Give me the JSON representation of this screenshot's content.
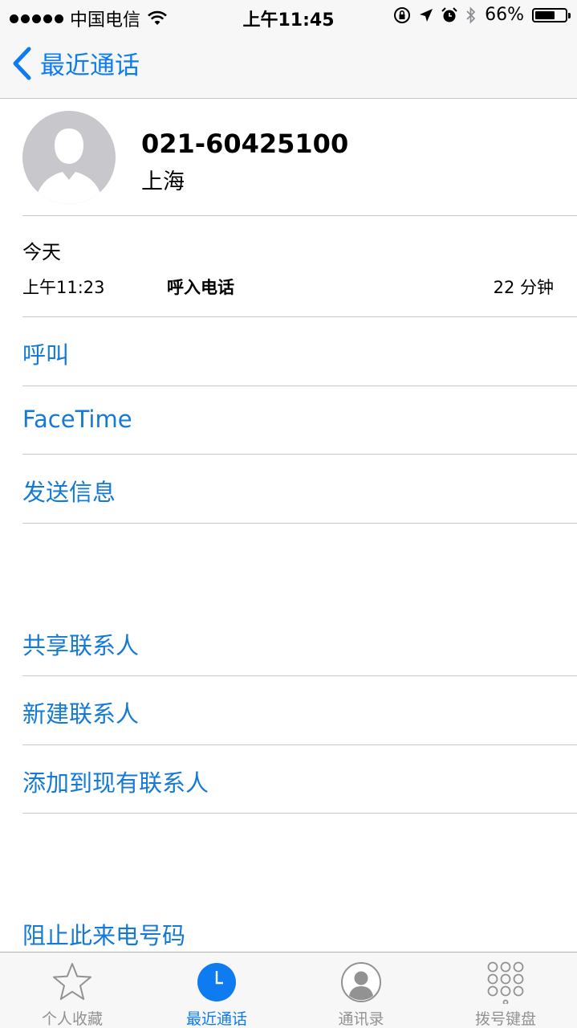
{
  "status_bar": {
    "carrier": "中国电信",
    "time": "上午11:45",
    "battery_percent": "66%",
    "battery_level": 0.66
  },
  "nav": {
    "back_label": "最近通话"
  },
  "contact": {
    "number": "021-60425100",
    "location": "上海"
  },
  "call_log": {
    "date": "今天",
    "entries": [
      {
        "time": "上午11:23",
        "type": "呼入电话",
        "duration": "22 分钟"
      }
    ]
  },
  "actions": {
    "call": "呼叫",
    "facetime": "FaceTime",
    "message": "发送信息",
    "share_contact": "共享联系人",
    "new_contact": "新建联系人",
    "add_to_existing": "添加到现有联系人",
    "block_caller": "阻止此来电号码"
  },
  "tab_bar": {
    "tabs": [
      {
        "label": "个人收藏",
        "icon": "star-icon",
        "active": false
      },
      {
        "label": "最近通话",
        "icon": "clock-icon",
        "active": true
      },
      {
        "label": "通讯录",
        "icon": "contact-icon",
        "active": false
      },
      {
        "label": "拨号键盘",
        "icon": "keypad-icon",
        "active": false
      }
    ]
  },
  "colors": {
    "accent": "#0f7bf0",
    "link": "#147ad6",
    "inactive_tab": "#929292",
    "separator": "#c8c7cc"
  }
}
